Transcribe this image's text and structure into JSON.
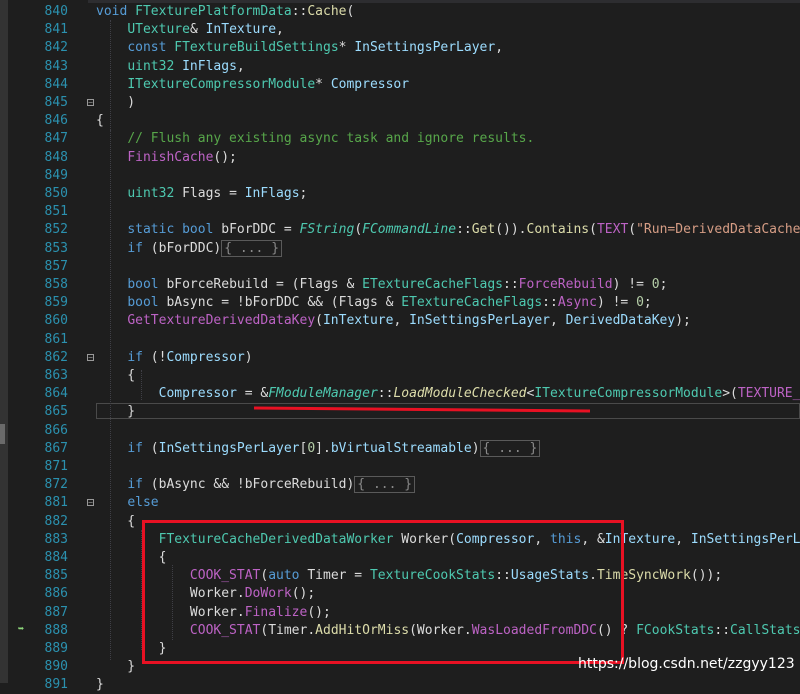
{
  "editor": {
    "lines": [
      {
        "num": "840",
        "html": "<span class='kw'>void</span> <span class='ty'>FTexturePlatformData</span>::<span class='fn'>Cache</span>("
      },
      {
        "num": "841",
        "html": "    <span class='ty'>UTexture</span>&amp; <span class='var'>InTexture</span>,"
      },
      {
        "num": "842",
        "html": "    <span class='kw'>const</span> <span class='ty'>FTextureBuildSettings</span>* <span class='var'>InSettingsPerLayer</span>,"
      },
      {
        "num": "843",
        "html": "    <span class='ty'>uint32</span> <span class='var'>InFlags</span>,"
      },
      {
        "num": "844",
        "html": "    <span class='ty'>ITextureCompressorModule</span>* <span class='var'>Compressor</span>"
      },
      {
        "num": "845",
        "html": "    )"
      },
      {
        "num": "846",
        "html": "{"
      },
      {
        "num": "847",
        "html": "    <span class='cm'>// Flush any existing async task and ignore results.</span>"
      },
      {
        "num": "848",
        "html": "    <span class='mac'>FinishCache</span>();"
      },
      {
        "num": "849",
        "html": ""
      },
      {
        "num": "850",
        "html": "    <span class='ty'>uint32</span> Flags = <span class='var'>InFlags</span>;"
      },
      {
        "num": "851",
        "html": ""
      },
      {
        "num": "852",
        "html": "    <span class='kw'>static</span> <span class='kw'>bool</span> bForDDC = <span class='ty it'>FString</span>(<span class='ty it'>FCommandLine</span>::<span class='fn'>Get</span>()).<span class='fn'>Contains</span>(<span class='mac'>TEXT</span>(<span class='str'>\"Run=DerivedDataCache\"</span>))"
      },
      {
        "num": "853",
        "html": "    <span class='kw'>if</span> (bForDDC)<span class='collapsed'>{ ... }</span>"
      },
      {
        "num": "857",
        "html": ""
      },
      {
        "num": "858",
        "html": "    <span class='kw'>bool</span> bForceRebuild = (Flags &amp; <span class='ty'>ETextureCacheFlags</span>::<span class='mac'>ForceRebuild</span>) != <span class='num'>0</span>;"
      },
      {
        "num": "859",
        "html": "    <span class='kw'>bool</span> bAsync = !bForDDC &amp;&amp; (Flags &amp; <span class='ty'>ETextureCacheFlags</span>::<span class='mac'>Async</span>) != <span class='num'>0</span>;"
      },
      {
        "num": "860",
        "html": "    <span class='mac'>GetTextureDerivedDataKey</span>(<span class='var'>InTexture</span>, <span class='var'>InSettingsPerLayer</span>, <span class='var'>DerivedDataKey</span>);"
      },
      {
        "num": "861",
        "html": ""
      },
      {
        "num": "862",
        "html": "    <span class='kw'>if</span> (!<span class='var'>Compressor</span>)"
      },
      {
        "num": "863",
        "html": "    {"
      },
      {
        "num": "864",
        "html": "        <span class='var'>Compressor</span> = &amp;<span class='ty it'>FModuleManager</span>::<span class='fn it'>LoadModuleChecked</span>&lt;<span class='ty'>ITextureCompressorModule</span>&gt;(<span class='mac'>TEXTURE_CO</span>"
      },
      {
        "num": "865",
        "html": "    }"
      },
      {
        "num": "866",
        "html": ""
      },
      {
        "num": "867",
        "html": "    <span class='kw'>if</span> (<span class='var'>InSettingsPerLayer</span>[<span class='num'>0</span>].<span class='var'>bVirtualStreamable</span>)<span class='collapsed'>{ ... }</span>"
      },
      {
        "num": "871",
        "html": ""
      },
      {
        "num": "872",
        "html": "    <span class='kw'>if</span> (bAsync &amp;&amp; !bForceRebuild)<span class='collapsed'>{ ... }</span>"
      },
      {
        "num": "881",
        "html": "    <span class='kw'>else</span>"
      },
      {
        "num": "882",
        "html": "    {"
      },
      {
        "num": "883",
        "html": "        <span class='ty'>FTextureCacheDerivedDataWorker</span> Worker(<span class='var'>Compressor</span>, <span class='kw'>this</span>, &amp;<span class='var'>InTexture</span>, <span class='var'>InSettingsPerLayer</span>"
      },
      {
        "num": "884",
        "html": "        {"
      },
      {
        "num": "885",
        "html": "            <span class='mac'>COOK_STAT</span>(<span class='kw'>auto</span> Timer = <span class='ty'>TextureCookStats</span>::<span class='var'>UsageStats</span>.<span class='fn'>TimeSyncWork</span>());"
      },
      {
        "num": "886",
        "html": "            Worker.<span class='mac'>DoWork</span>();"
      },
      {
        "num": "887",
        "html": "            Worker.<span class='mac'>Finalize</span>();"
      },
      {
        "num": "888",
        "html": "            <span class='mac'>COOK_STAT</span>(Timer.<span class='fn'>AddHitOrMiss</span>(Worker.<span class='mac'>WasLoadedFromDDC</span>() ? <span class='ty'>FCookStats</span>::<span class='ty'>CallStats</span>::"
      },
      {
        "num": "889",
        "html": "        }"
      },
      {
        "num": "890",
        "html": "    }"
      },
      {
        "num": "891",
        "html": "}"
      }
    ]
  },
  "watermark": "https://blog.csdn.net/zzgyy123"
}
